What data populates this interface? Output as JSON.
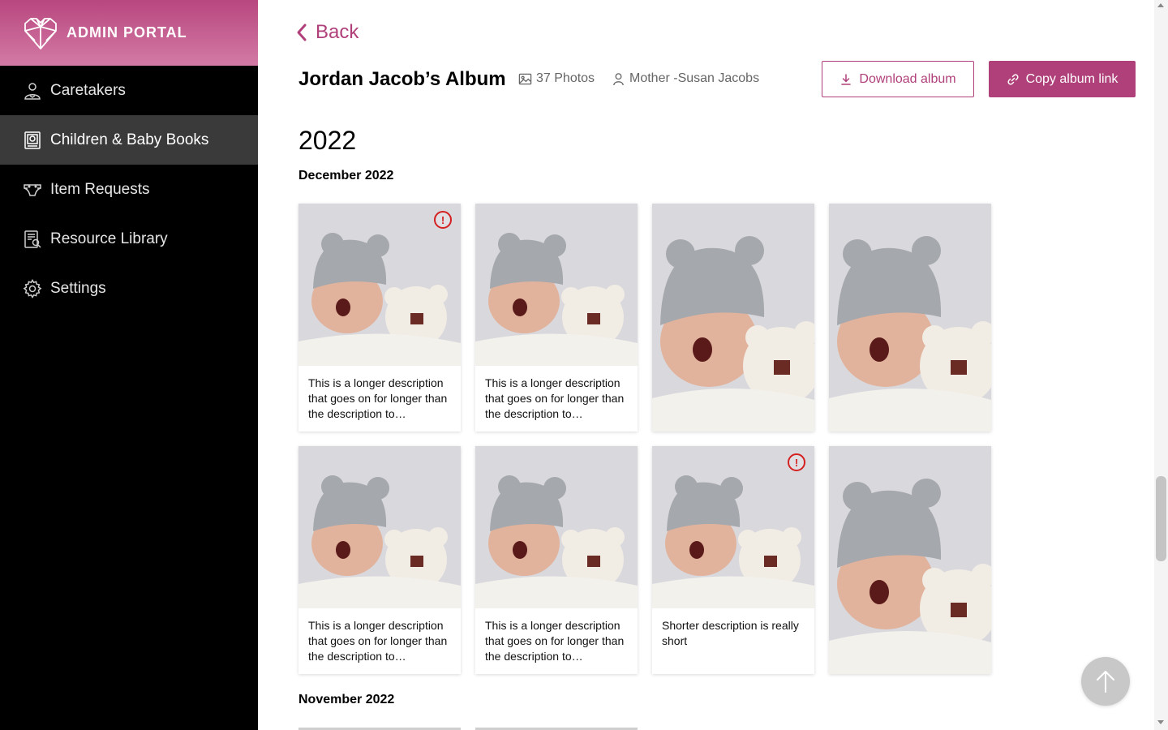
{
  "brand": {
    "label": "ADMIN PORTAL",
    "logo_icon": "heart-logo-icon",
    "color_start": "#b8477f",
    "color_end": "#d37aa5"
  },
  "sidebar": {
    "items": [
      {
        "label": "Caretakers",
        "icon": "caretaker-icon",
        "active": false
      },
      {
        "label": "Children & Baby Books",
        "icon": "baby-book-icon",
        "active": true
      },
      {
        "label": "Item Requests",
        "icon": "diaper-icon",
        "active": false
      },
      {
        "label": "Resource Library",
        "icon": "library-search-icon",
        "active": false
      },
      {
        "label": "Settings",
        "icon": "gear-icon",
        "active": false
      }
    ]
  },
  "header": {
    "back_label": "Back",
    "album_title": "Jordan Jacob’s Album",
    "photo_count": "37 Photos",
    "owner": "Mother -Susan Jacobs",
    "download_label": "Download album",
    "copy_label": "Copy album link"
  },
  "accent_color": "#b0407a",
  "alert_color": "#d42020",
  "year": "2022",
  "months": [
    {
      "label": "December 2022",
      "photos": [
        {
          "description": "This is a longer description that goes on for longer than the description to…",
          "alert": true
        },
        {
          "description": "This is a longer description that goes on for longer than the description to…",
          "alert": false
        },
        {
          "description": "",
          "alert": false
        },
        {
          "description": "",
          "alert": false
        },
        {
          "description": "This is a longer description that goes on for longer than the description to…",
          "alert": false
        },
        {
          "description": "This is a longer description that goes on for longer than the description to…",
          "alert": false
        },
        {
          "description": "Shorter description is really short",
          "alert": true
        },
        {
          "description": "",
          "alert": false
        }
      ]
    },
    {
      "label": "November 2022",
      "photos": []
    }
  ],
  "alert_glyph": "!",
  "scroll_top_icon": "arrow-up-icon"
}
